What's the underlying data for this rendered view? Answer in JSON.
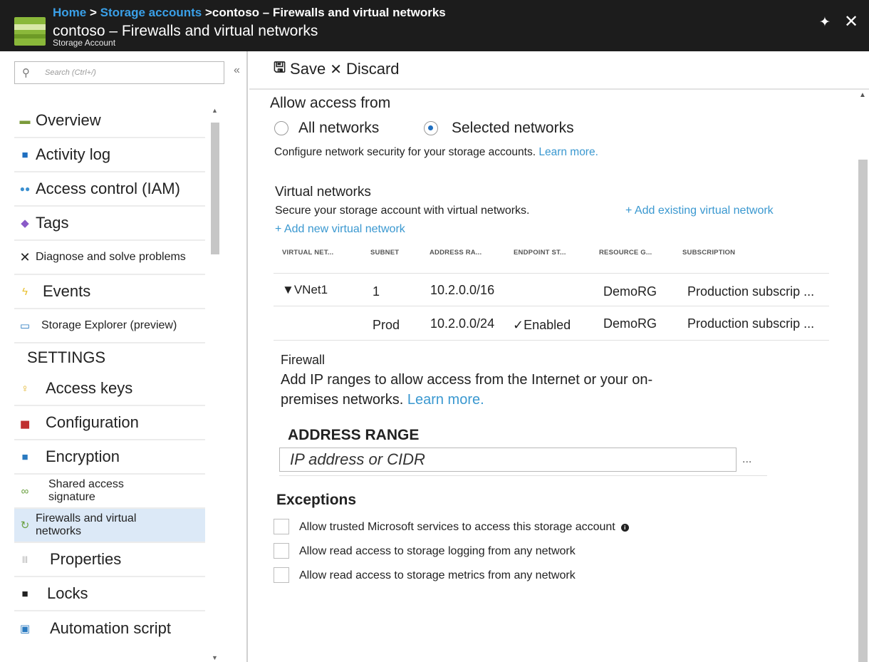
{
  "header": {
    "breadcrumb": {
      "home": "Home",
      "sep1": " > ",
      "storage": "Storage accounts",
      "sep2": " >",
      "current": "contoso – Firewalls and virtual networks"
    },
    "title": "contoso – Firewalls and virtual networks",
    "subtitle": "Storage Account",
    "pin_icon": "pin-icon",
    "close_icon": "close-icon"
  },
  "sidebar": {
    "search_placeholder": "Search (Ctrl+/)",
    "collapse_label": "«",
    "items": [
      {
        "label": "Overview",
        "icon": "overview-icon",
        "glyph": "▬",
        "color": "#7a9a3a"
      },
      {
        "label": "Activity log",
        "icon": "activity-log-icon",
        "glyph": "■",
        "color": "#1f6fc0"
      },
      {
        "label": "Access control (IAM)",
        "icon": "people-icon",
        "glyph": "👥",
        "color": "#3a8fd0"
      },
      {
        "label": "Tags",
        "icon": "tag-icon",
        "glyph": "◆",
        "color": "#8a5ac8"
      },
      {
        "label": "Diagnose and solve problems",
        "icon": "wrench-icon",
        "glyph": "✕",
        "color": "#222222"
      },
      {
        "label": "Events",
        "icon": "lightning-icon",
        "glyph": "⚡",
        "color": "#e8c030"
      },
      {
        "label": "Storage Explorer (preview)",
        "icon": "monitor-icon",
        "glyph": "▭",
        "color": "#2a7ac0"
      },
      {
        "label": "SETTINGS"
      },
      {
        "label": "Access keys",
        "icon": "key-icon",
        "glyph": "🔑",
        "color": "#e0b020"
      },
      {
        "label": "Configuration",
        "icon": "toolbox-icon",
        "glyph": "▅",
        "color": "#c03030"
      },
      {
        "label": "Encryption",
        "icon": "lock-icon",
        "glyph": "🔒",
        "color": "#2a7ac0"
      },
      {
        "label": "Shared access signature",
        "icon": "link-icon",
        "glyph": "∞",
        "color": "#6aa040"
      },
      {
        "label": "Firewalls and virtual networks",
        "icon": "network-icon",
        "glyph": "↻",
        "color": "#6aa040"
      },
      {
        "label": "Properties",
        "icon": "properties-icon",
        "glyph": "⦙⦙",
        "color": "#999999"
      },
      {
        "label": "Locks",
        "icon": "lock-icon",
        "glyph": "🔒",
        "color": "#222222"
      },
      {
        "label": "Automation script",
        "icon": "script-icon",
        "glyph": "▣",
        "color": "#2a7ac0"
      }
    ]
  },
  "toolbar": {
    "save_label": "Save",
    "discard_label": "Discard"
  },
  "access": {
    "heading": "Allow access from",
    "option_all": "All networks",
    "option_selected": "Selected networks",
    "selected": "Selected networks",
    "description": "Configure network security for your storage accounts.",
    "learn_more": "Learn more."
  },
  "vnets": {
    "heading": "Virtual networks",
    "description": "Secure your storage account with virtual networks.",
    "add_existing": "+ Add existing virtual network",
    "add_new": "+ Add new virtual network",
    "columns": [
      "VIRTUAL NET...",
      "SUBNET",
      "ADDRESS RA...",
      "ENDPOINT ST...",
      "RESOURCE G...",
      "SUBSCRIPTION"
    ],
    "rows": [
      {
        "vnet": "▼VNet1",
        "subnet": "1",
        "address": "10.2.0.0/16",
        "endpoint": "",
        "rg": "DemoRG",
        "subscription": "Production subscrip ..."
      },
      {
        "vnet": "",
        "subnet": "Prod",
        "address": "10.2.0.0/24",
        "endpoint": "✓Enabled",
        "rg": "DemoRG",
        "subscription": "Production subscrip ..."
      }
    ]
  },
  "firewall": {
    "heading": "Firewall",
    "description_1": "Add IP ranges to allow access from the Internet or  your on-",
    "description_2": "premises networks.",
    "learn_more": "Learn more.",
    "address_header": "ADDRESS RANGE",
    "address_placeholder": "IP address or CIDR",
    "more": "..."
  },
  "exceptions": {
    "heading": "Exceptions",
    "items": [
      {
        "label": "Allow trusted Microsoft services to access this storage account",
        "checked": false,
        "info": "i"
      },
      {
        "label": "Allow read access to storage logging from any network",
        "checked": false
      },
      {
        "label": "Allow read access to storage metrics from any network",
        "checked": false
      }
    ]
  }
}
